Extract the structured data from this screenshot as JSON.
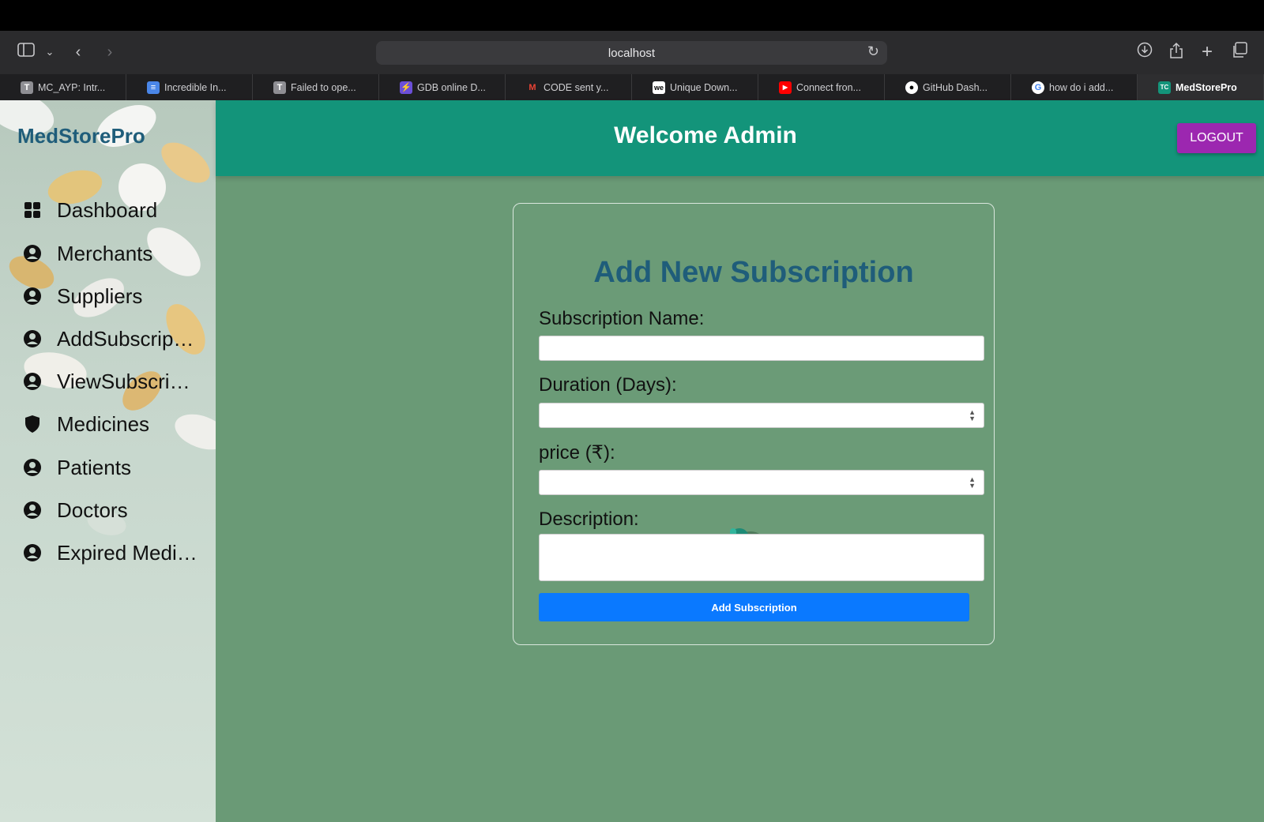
{
  "browser": {
    "url": "localhost",
    "tabs": [
      {
        "label": "MC_AYP: Intr...",
        "favicon": "T",
        "color": "#8e8e93"
      },
      {
        "label": "Incredible In...",
        "favicon": "≡",
        "color": "#4a86e8"
      },
      {
        "label": "Failed to ope...",
        "favicon": "T",
        "color": "#8e8e93"
      },
      {
        "label": "GDB online D...",
        "favicon": "⚡",
        "color": "#6b4fd8"
      },
      {
        "label": "CODE sent y...",
        "favicon": "M",
        "color": "#ea4335"
      },
      {
        "label": "Unique Down...",
        "favicon": "we",
        "color": "#ffffff"
      },
      {
        "label": "Connect fron...",
        "favicon": "▶",
        "color": "#ff0000"
      },
      {
        "label": "GitHub Dash...",
        "favicon": "●",
        "color": "#ffffff"
      },
      {
        "label": "how do i add...",
        "favicon": "G",
        "color": "#4285f4"
      },
      {
        "label": "MedStorePro",
        "favicon": "TC",
        "color": "#13947a",
        "active": true
      }
    ]
  },
  "sidebar": {
    "brand": "MedStorePro",
    "items": [
      {
        "label": "Dashboard",
        "icon": "grid-icon"
      },
      {
        "label": "Merchants",
        "icon": "user-circle-icon"
      },
      {
        "label": "Suppliers",
        "icon": "user-circle-icon"
      },
      {
        "label": "AddSubscriptions",
        "icon": "user-circle-icon"
      },
      {
        "label": "ViewSubscriptions",
        "icon": "user-circle-icon"
      },
      {
        "label": "Medicines",
        "icon": "shield-icon"
      },
      {
        "label": "Patients",
        "icon": "user-circle-icon"
      },
      {
        "label": "Doctors",
        "icon": "user-circle-icon"
      },
      {
        "label": "Expired Medicines",
        "icon": "user-circle-icon"
      }
    ]
  },
  "header": {
    "welcome": "Welcome Admin",
    "logout_label": "LOGOUT"
  },
  "form": {
    "title": "Add New Subscription",
    "name_label": "Subscription Name:",
    "name_value": "",
    "duration_label": "Duration (Days):",
    "duration_value": "",
    "price_label": "price (₹):",
    "price_value": "",
    "description_label": "Description:",
    "description_value": "",
    "submit_label": "Add Subscription"
  },
  "colors": {
    "header": "#13947a",
    "brand": "#1f5d7a",
    "logout": "#9c27b0",
    "submit": "#0a79ff",
    "background": "#6a9a76"
  }
}
